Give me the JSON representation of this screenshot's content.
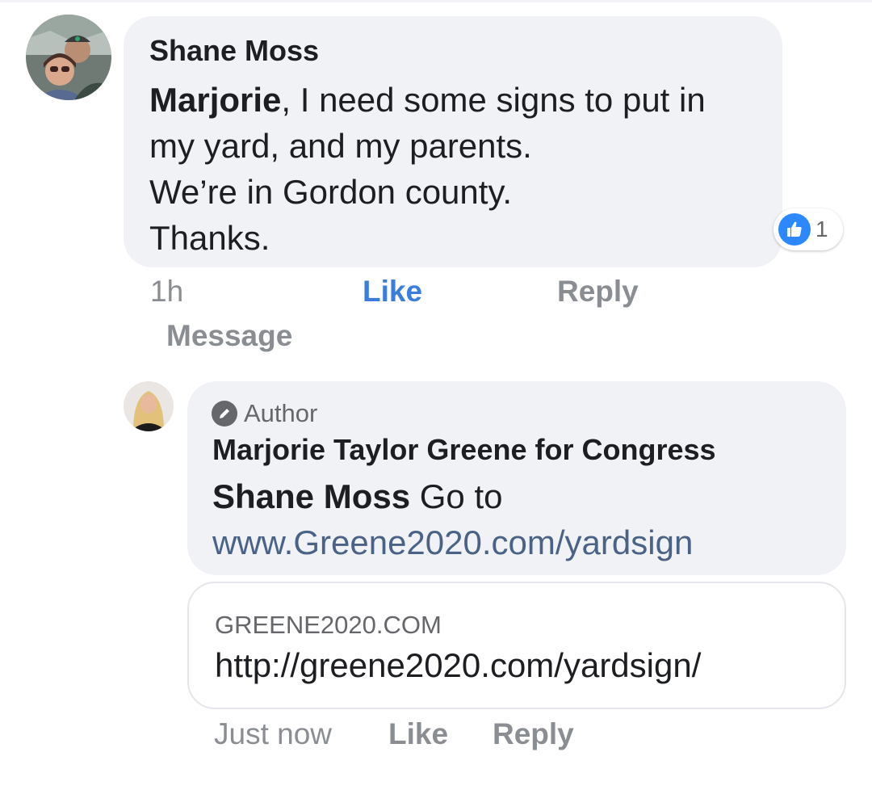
{
  "colors": {
    "bubble": "#f0f2f5",
    "like_active": "#3b7ddd",
    "reaction_blue": "#2d88ff",
    "muted_text": "#8a8d91",
    "link_text": "#4b6287"
  },
  "comment": {
    "author": "Shane Moss",
    "mention": "Marjorie",
    "lines": [
      ", I need some signs to put in",
      "my yard, and my parents.",
      "We’re in Gordon county.",
      "Thanks."
    ],
    "reaction": {
      "icon": "thumbs-up-icon",
      "count": "1"
    },
    "time": "1h",
    "like_label": "Like",
    "reply_label": "Reply",
    "message_label": "Message"
  },
  "reply": {
    "badge_icon": "pencil-icon",
    "badge_label": "Author",
    "author": "Marjorie Taylor Greene for Congress",
    "mention": "Shane Moss",
    "text": " Go to",
    "link": "www.Greene2020.com/yardsign",
    "preview": {
      "domain": "GREENE2020.COM",
      "url": "http://greene2020.com/yardsign/"
    },
    "time": "Just now",
    "like_label": "Like",
    "reply_label": "Reply"
  }
}
